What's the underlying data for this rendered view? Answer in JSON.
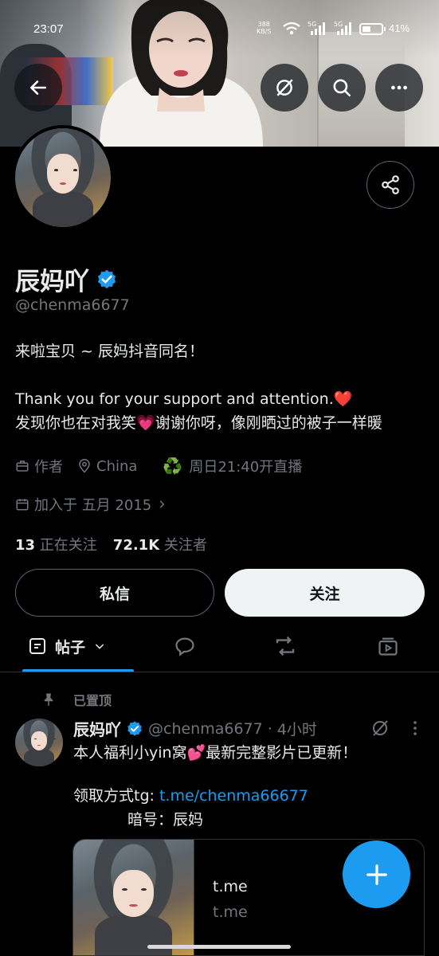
{
  "status_bar": {
    "time": "23:07",
    "net_speed_value": "388",
    "net_speed_unit": "KB/S",
    "signal1_label": "5G",
    "signal2_label": "5G",
    "battery": "41%",
    "battery_level": 0.41
  },
  "profile": {
    "name": "辰妈吖",
    "verified": true,
    "handle": "@chenma6677",
    "bio": {
      "line1": "来啦宝贝 ~ 辰妈抖音同名！",
      "line2_text": "Thank you for your support and attention.",
      "line2_emoji": "❤️",
      "line3_a": "发现你也在对我笑",
      "line3_emoji": "💗",
      "line3_b": "谢谢你呀，像刚晒过的被子一样暖"
    },
    "meta": {
      "category": "作者",
      "location": "China",
      "live_emoji": "♻️",
      "live": "周日21:40开直播",
      "joined": "加入于 五月 2015"
    },
    "following_count": "13",
    "following_label": "正在关注",
    "followers_count": "72.1K",
    "followers_label": "关注者",
    "dm_label": "私信",
    "follow_label": "关注"
  },
  "tabs": {
    "posts_label": "帖子"
  },
  "pinned_post": {
    "pinned_label": "已置顶",
    "author_name": "辰妈吖",
    "author_handle": "@chenma6677",
    "separator": "·",
    "time": "4小时",
    "text_line1_a": "本人福利小yin窝",
    "text_line1_emoji": "💕",
    "text_line1_b": "最新完整影片已更新！",
    "text_line2_prefix": "领取方式tg: ",
    "text_line2_link": "t.me/chenma66677",
    "text_line3": "暗号：辰妈",
    "card_domain": "t.me",
    "card_subtitle": "t.me"
  },
  "colors": {
    "accent": "#1d9bf0",
    "background": "#000000",
    "text_primary": "#e7e9ea",
    "text_secondary": "#71767b",
    "border": "#2f3336"
  },
  "icons": [
    "back-arrow-icon",
    "grok-icon",
    "search-icon",
    "more-icon",
    "share-icon",
    "verified-badge-icon",
    "briefcase-icon",
    "location-pin-icon",
    "calendar-icon",
    "chevron-right-icon",
    "posts-icon",
    "chevron-down-icon",
    "reply-icon",
    "repost-icon",
    "media-icon",
    "pin-icon",
    "compose-plus-icon"
  ]
}
